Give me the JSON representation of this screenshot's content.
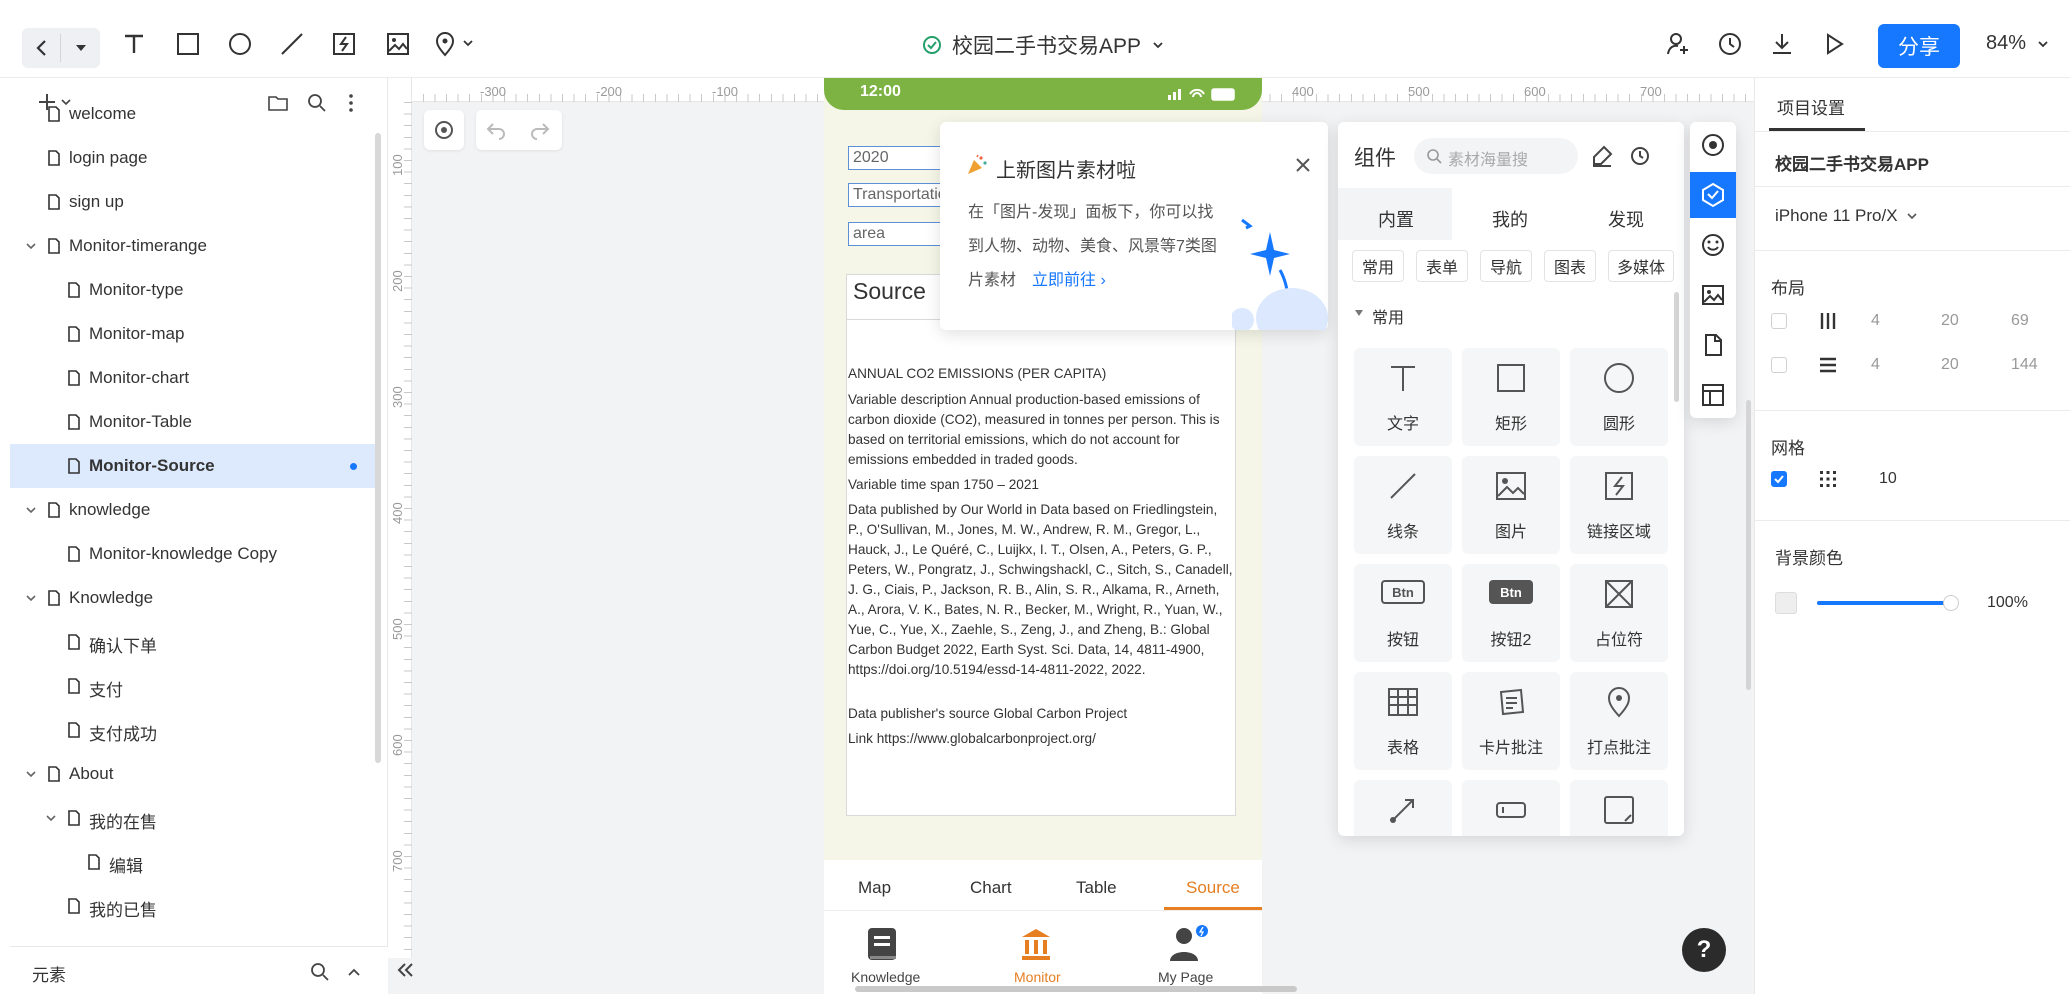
{
  "topbar": {
    "project_title": "校园二手书交易APP",
    "share_label": "分享",
    "zoom": "84%"
  },
  "left_panel": {
    "items": [
      {
        "label": "welcome"
      },
      {
        "label": "login page"
      },
      {
        "label": "sign up"
      },
      {
        "label": "Monitor-timerange"
      },
      {
        "label": "Monitor-type"
      },
      {
        "label": "Monitor-map"
      },
      {
        "label": "Monitor-chart"
      },
      {
        "label": "Monitor-Table"
      },
      {
        "label": "Monitor-Source"
      },
      {
        "label": "knowledge"
      },
      {
        "label": "Monitor-knowledge Copy"
      },
      {
        "label": "Knowledge"
      },
      {
        "label": "确认下单"
      },
      {
        "label": "支付"
      },
      {
        "label": "支付成功"
      },
      {
        "label": "About"
      },
      {
        "label": "我的在售"
      },
      {
        "label": "编辑"
      },
      {
        "label": "我的已售"
      }
    ],
    "elements_label": "元素"
  },
  "rulers": {
    "top": [
      "-300",
      "-200",
      "-100",
      "400",
      "500",
      "600",
      "700"
    ],
    "left": [
      "100",
      "200",
      "300",
      "400",
      "500",
      "600",
      "700"
    ]
  },
  "phone": {
    "time": "12:00",
    "field_year": "2020",
    "field_type": "Transportation",
    "field_area": "area",
    "source_title": "Source",
    "source_heading": "ANNUAL CO2 EMISSIONS (PER CAPITA)",
    "source_desc": "Variable description       Annual production-based emissions of carbon dioxide (CO2), measured in tonnes per person. This is based on territorial emissions, which do not account for emissions embedded in traded goods.",
    "source_span": "Variable time span  1750 – 2021",
    "source_published": "Data published by   Our World in Data based on Friedlingstein, P., O'Sullivan, M., Jones, M. W., Andrew, R. M., Gregor, L., Hauck, J., Le Quéré, C., Luijkx, I. T., Olsen, A., Peters, G. P., Peters, W., Pongratz, J., Schwingshackl, C., Sitch, S., Canadell, J. G., Ciais, P., Jackson, R. B., Alin, S. R., Alkama, R., Arneth, A., Arora, V. K., Bates, N. R., Becker, M., Wright, R., Yuan, W., Yue, C., Yue, X., Zaehle, S., Zeng, J., and Zheng, B.: Global Carbon Budget 2022, Earth Syst. Sci. Data, 14, 4811-4900, https://doi.org/10.5194/essd-14-4811-2022, 2022.",
    "source_publisher": "Data publisher's source  Global Carbon Project",
    "source_link": "Link https://www.globalcarbonproject.org/",
    "tabs": [
      "Map",
      "Chart",
      "Table",
      "Source"
    ],
    "nav": [
      "Knowledge",
      "Monitor",
      "My Page"
    ]
  },
  "popup": {
    "title": "上新图片素材啦",
    "line1": "在「图片-发现」面板下，你可以找",
    "line2": "到人物、动物、美食、风景等7类图",
    "line3": "片素材",
    "link": "立即前往"
  },
  "components": {
    "title": "组件",
    "search_placeholder": "素材海量搜",
    "tabs": [
      "内置",
      "我的",
      "发现"
    ],
    "chips": [
      "常用",
      "表单",
      "导航",
      "图表",
      "多媒体"
    ],
    "section": "常用",
    "tiles": [
      "文字",
      "矩形",
      "圆形",
      "线条",
      "图片",
      "链接区域",
      "按钮",
      "按钮2",
      "占位符",
      "表格",
      "卡片批注",
      "打点批注"
    ],
    "btn_text": "Btn"
  },
  "right_panel": {
    "tab": "项目设置",
    "project_name": "校园二手书交易APP",
    "device": "iPhone 11 Pro/X",
    "layout_label": "布局",
    "layout_rows": [
      {
        "a": "4",
        "b": "20",
        "c": "69"
      },
      {
        "a": "4",
        "b": "20",
        "c": "144"
      }
    ],
    "grid_label": "网格",
    "grid_value": "10",
    "bg_label": "背景颜色",
    "bg_opacity": "100%"
  },
  "colors": {
    "accent": "#1677ff",
    "phone_status": "#7cb342",
    "phone_active_tab": "#e67e22"
  }
}
